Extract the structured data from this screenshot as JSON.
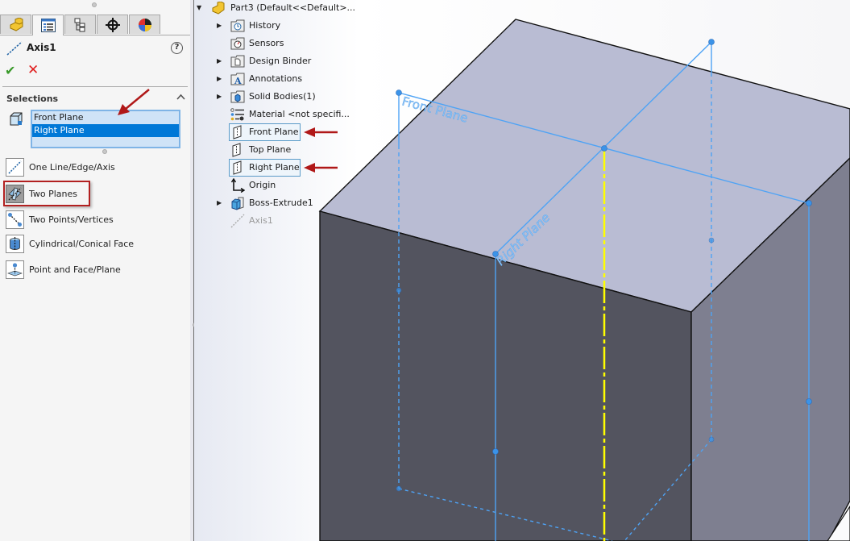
{
  "property_manager": {
    "tabs": [
      {
        "name": "feature-manager",
        "icon": "part-icon"
      },
      {
        "name": "property-manager",
        "icon": "property-manager-icon",
        "active": true
      },
      {
        "name": "configuration-manager",
        "icon": "configuration-icon"
      },
      {
        "name": "dimxpert-manager",
        "icon": "crosshair-icon"
      },
      {
        "name": "display-manager",
        "icon": "appearance-ball-icon"
      }
    ],
    "title": "Axis1",
    "help_label": "?",
    "ok_label": "✔",
    "cancel_label": "✕",
    "selections": {
      "heading": "Selections",
      "collapse": "⌃",
      "items": [
        {
          "label": "Front Plane",
          "selected": false
        },
        {
          "label": "Right Plane",
          "selected": true
        }
      ]
    },
    "options": [
      {
        "label": "One Line/Edge/Axis",
        "icon": "line-edge-axis-icon",
        "active": false
      },
      {
        "label": "Two Planes",
        "icon": "two-planes-icon",
        "active": true
      },
      {
        "label": "Two Points/Vertices",
        "icon": "two-points-icon",
        "active": false
      },
      {
        "label": "Cylindrical/Conical Face",
        "icon": "cylindrical-face-icon",
        "active": false
      },
      {
        "label": "Point and Face/Plane",
        "icon": "point-face-icon",
        "active": false
      }
    ]
  },
  "feature_tree": {
    "root": {
      "label": "Part3  (Default<<Default>...",
      "expanded": true
    },
    "items": [
      {
        "label": "History",
        "expandable": true,
        "icon": "history-folder-icon"
      },
      {
        "label": "Sensors",
        "expandable": false,
        "icon": "sensors-folder-icon"
      },
      {
        "label": "Design Binder",
        "expandable": true,
        "icon": "design-binder-icon"
      },
      {
        "label": "Annotations",
        "expandable": true,
        "icon": "annotations-icon"
      },
      {
        "label": "Solid Bodies(1)",
        "expandable": true,
        "icon": "solid-bodies-icon"
      },
      {
        "label": "Material <not specifi...",
        "expandable": false,
        "icon": "material-icon"
      },
      {
        "label": "Front Plane",
        "expandable": false,
        "icon": "plane-icon",
        "selected": true
      },
      {
        "label": "Top Plane",
        "expandable": false,
        "icon": "plane-icon"
      },
      {
        "label": "Right Plane",
        "expandable": false,
        "icon": "plane-icon",
        "selected": true
      },
      {
        "label": "Origin",
        "expandable": false,
        "icon": "origin-icon"
      },
      {
        "label": "Boss-Extrude1",
        "expandable": true,
        "icon": "boss-extrude-icon"
      },
      {
        "label": "Axis1",
        "expandable": false,
        "icon": "axis-icon",
        "dimmed": true
      }
    ]
  },
  "viewport": {
    "plane_labels": {
      "front": "Front Plane",
      "right": "Right Plane"
    },
    "colors": {
      "top_face": "#b9bcd3",
      "left_face": "#53545f",
      "right_face": "#7e7f90",
      "plane_line": "#4ea3f5",
      "axis_preview": "#ffff00",
      "annotation_arrow": "#b01818"
    }
  }
}
